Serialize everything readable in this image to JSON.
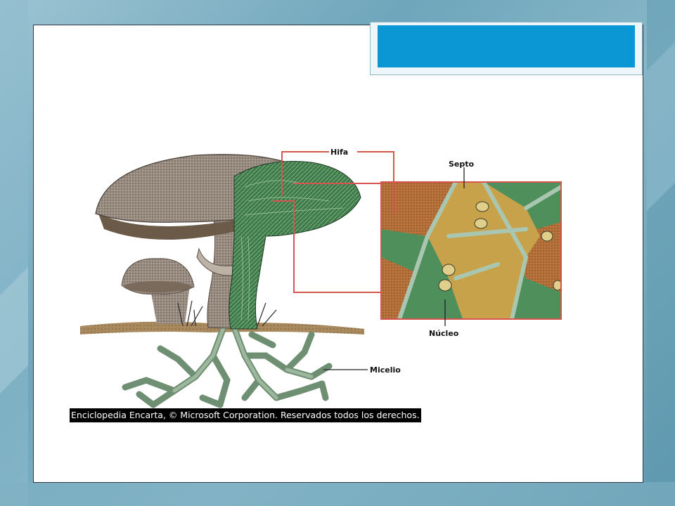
{
  "slide": {
    "labels": {
      "hifa": "Hifa",
      "septo": "Septo",
      "nucleo": "Núcleo",
      "micelio": "Micelio"
    },
    "caption": "Enciclopedia Encarta, © Microsoft Corporation. Reservados todos los derechos."
  },
  "colors": {
    "title_bar": "#0b97d3",
    "pointer_lines": "#d9534f",
    "hypha_green": "#4f8a5a",
    "cell_tan": "#c8a24a",
    "soil_brown": "#9a7a50",
    "cap_brown": "#8f8174"
  }
}
